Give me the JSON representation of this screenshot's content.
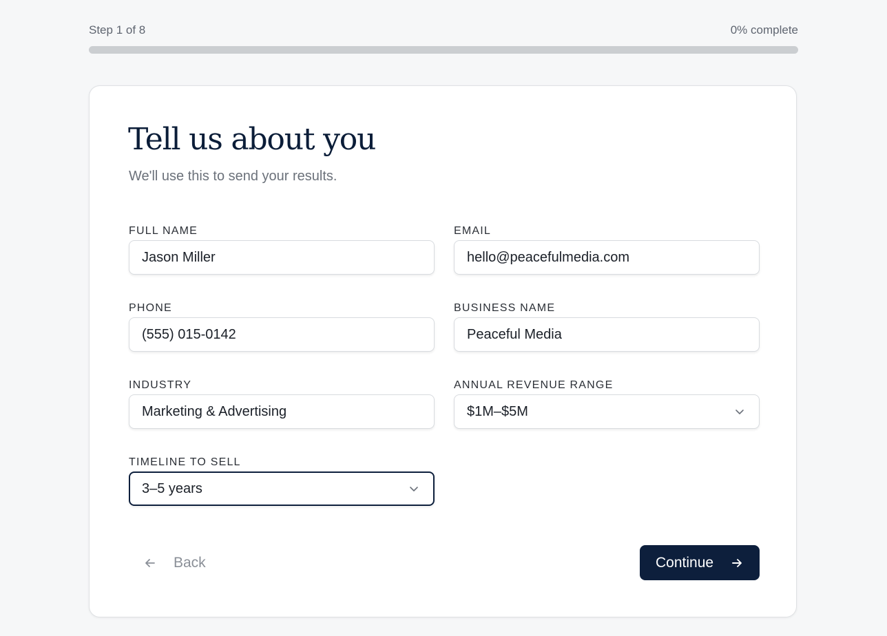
{
  "progress": {
    "step_text": "Step 1 of 8",
    "percent_text": "0% complete",
    "fraction": 0
  },
  "form": {
    "title": "Tell us about you",
    "subtitle": "We'll use this to send your results.",
    "fields": {
      "full_name": {
        "label": "FULL NAME",
        "value": "Jason Miller"
      },
      "email": {
        "label": "EMAIL",
        "value": "hello@peacefulmedia.com"
      },
      "phone": {
        "label": "PHONE",
        "value": "(555) 015-0142"
      },
      "business_name": {
        "label": "BUSINESS NAME",
        "value": "Peaceful Media"
      },
      "industry": {
        "label": "INDUSTRY",
        "value": "Marketing & Advertising"
      },
      "annual_revenue": {
        "label": "ANNUAL REVENUE RANGE",
        "value": "$1M–$5M"
      },
      "timeline": {
        "label": "TIMELINE TO SELL",
        "value": "3–5 years"
      }
    }
  },
  "actions": {
    "back_label": "Back",
    "continue_label": "Continue"
  },
  "icons": {
    "back": "arrow-left-icon",
    "continue": "arrow-right-icon",
    "select": "chevron-down-icon"
  },
  "colors": {
    "primary": "#0d1f3c",
    "background": "#f6f7f8",
    "track": "#cbced1"
  }
}
